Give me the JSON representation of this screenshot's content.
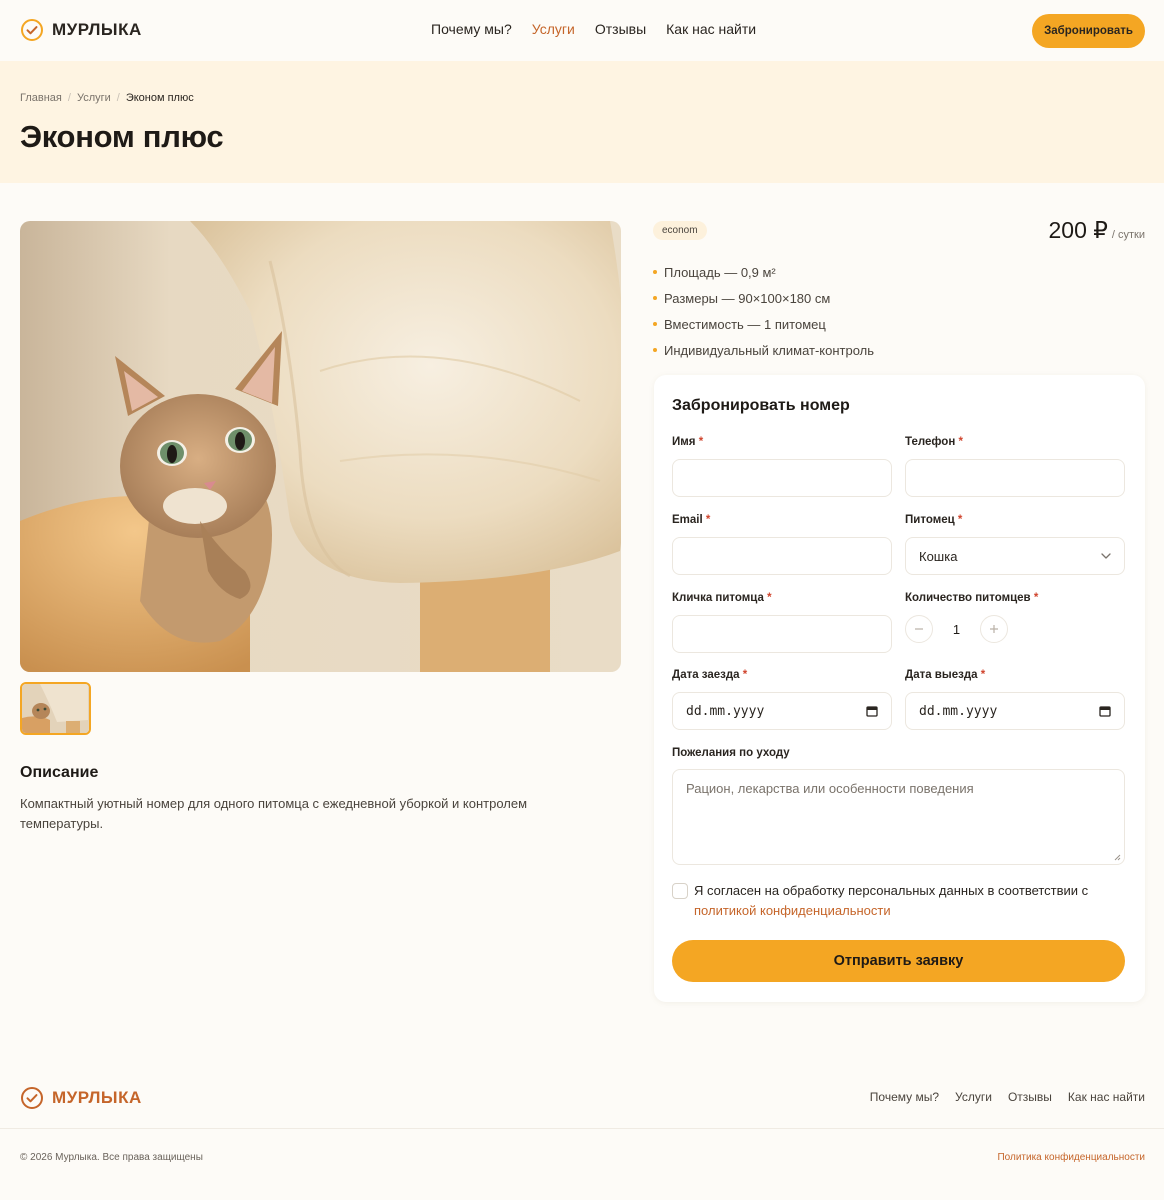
{
  "header": {
    "logo_text": "МУРЛЫКА",
    "nav": [
      {
        "label": "Почему мы?",
        "active": false
      },
      {
        "label": "Услуги",
        "active": true
      },
      {
        "label": "Отзывы",
        "active": false
      },
      {
        "label": "Как нас найти",
        "active": false
      }
    ],
    "book_button": "Забронировать"
  },
  "breadcrumb": {
    "home": "Главная",
    "services": "Услуги",
    "current": "Эконом плюс",
    "separator": "/"
  },
  "page": {
    "title": "Эконом плюс"
  },
  "gallery": {
    "main_image": "kitten-in-cat-tree-photo",
    "thumbnails_count": 1
  },
  "description": {
    "title": "Описание",
    "text": "Компактный уютный номер для одного питомца с ежедневной уборкой и контролем температуры."
  },
  "room": {
    "badge": "econom",
    "price": "200 ₽",
    "price_unit": "/ сутки",
    "features": [
      "Площадь — 0,9 м²",
      "Размеры — 90×100×180 см",
      "Вместимость — 1 питомец",
      "Индивидуальный климат-контроль"
    ]
  },
  "form": {
    "title": "Забронировать номер",
    "required_mark": "*",
    "name_label": "Имя",
    "name_value": "",
    "phone_label": "Телефон",
    "phone_value": "",
    "email_label": "Email",
    "email_value": "",
    "pet_label": "Питомец",
    "pet_value": "Кошка",
    "pet_name_label": "Кличка питомца",
    "pet_name_value": "",
    "pet_count_label": "Количество питомцев",
    "pet_count_value": "1",
    "checkin_label": "Дата заезда",
    "checkin_placeholder": "dd.mm.yyyy",
    "checkout_label": "Дата выезда",
    "checkout_placeholder": "dd.mm.yyyy",
    "wishes_label": "Пожелания по уходу",
    "wishes_placeholder": "Рацион, лекарства или особенности поведения",
    "consent_text": "Я согласен на обработку персональных данных в соответствии с",
    "consent_link": "политикой конфиденциальности",
    "consent_checked": false,
    "submit": "Отправить заявку"
  },
  "footer": {
    "logo_text": "МУРЛЫКА",
    "nav": [
      "Почему мы?",
      "Услуги",
      "Отзывы",
      "Как нас найти"
    ],
    "copyright": "© 2026 Мурлыка. Все права защищены",
    "privacy": "Политика конфиденциальности"
  },
  "colors": {
    "accent": "#f4a623",
    "brand_rust": "#c5652a",
    "hero_bg": "#fef4e2",
    "page_bg": "#fdfbf7",
    "required": "#d0452e"
  }
}
